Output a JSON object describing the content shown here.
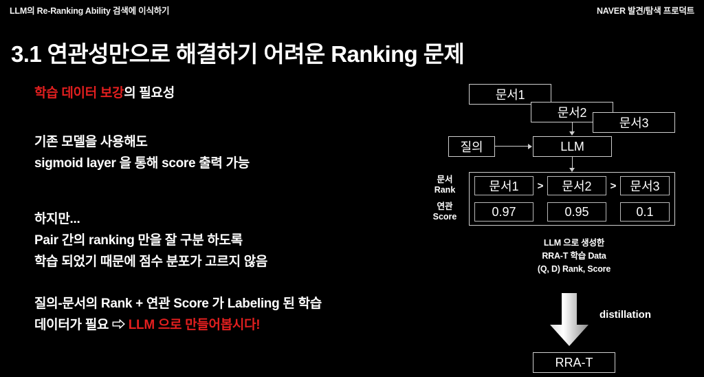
{
  "header": {
    "left_title": "LLM의 Re-Ranking Ability 검색에 이식하기",
    "right_title": "NAVER 발견/탐색 프로덕트"
  },
  "slide": {
    "title": "3.1 연관성만으로 해결하기 어려운 Ranking 문제"
  },
  "body": {
    "highlight_text": "학습 데이터 보강",
    "highlight_suffix": "의 필요성",
    "para2_line1": "기존 모델을 사용해도",
    "para2_line2": "sigmoid layer 을 통해 score 출력 가능",
    "para3_line1": "하지만...",
    "para3_line2": "Pair 간의 ranking 만을 잘 구분 하도록",
    "para3_line3": "학습 되었기 때문에 점수 분포가 고르지 않음",
    "para4_line1": "질의-문서의 Rank  + 연관 Score 가 Labeling 된 학습",
    "para4_line2_prefix": "데이터가 필요 ⇨ ",
    "para4_line2_highlight": "LLM 으로 만들어봅시다!"
  },
  "diagram": {
    "doc1": "문서1",
    "doc2": "문서2",
    "doc3": "문서3",
    "query": "질의",
    "llm": "LLM",
    "rank_label_line1": "문서",
    "rank_label_line2": "Rank",
    "score_label_line1": "연관",
    "score_label_line2": "Score",
    "rank_cells": [
      "문서1",
      "문서2",
      "문서3"
    ],
    "rank_separators": [
      ">",
      ">"
    ],
    "score_cells": [
      "0.97",
      "0.95",
      "0.1"
    ],
    "caption_line1": "LLM 으로 생성한",
    "caption_line2": "RRA-T 학습 Data",
    "caption_line3": "(Q, D)  Rank, Score",
    "distillation_label": "distillation",
    "output_box": "RRA-T"
  },
  "colors": {
    "background": "#000000",
    "text": "#ffffff",
    "accent_red": "#e21f1f",
    "box_border": "#cfcfcf"
  }
}
